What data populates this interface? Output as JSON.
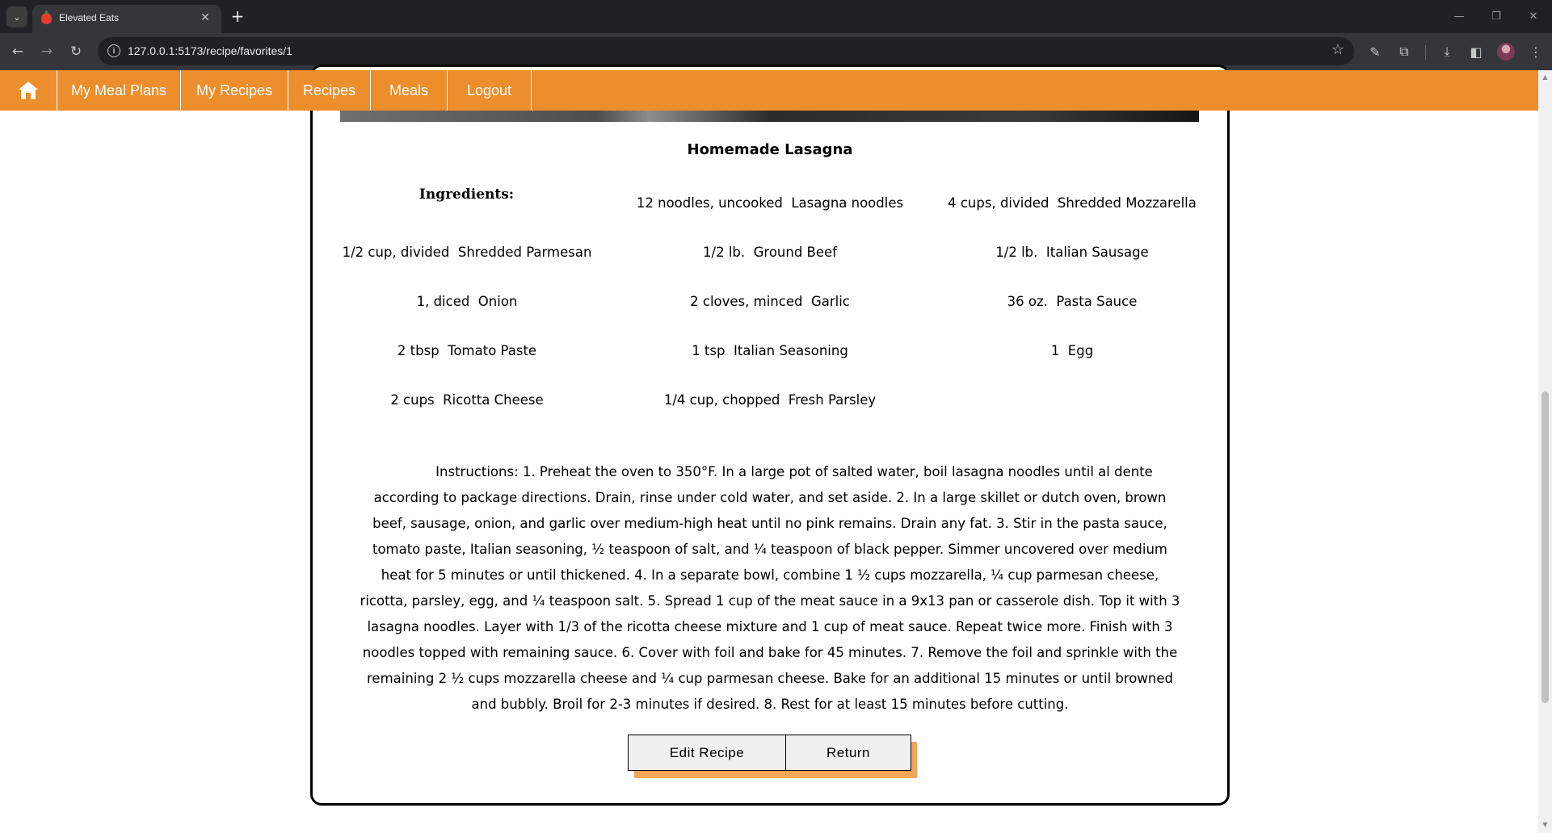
{
  "browser": {
    "tab_title": "Elevated Eats",
    "tab_close": "✕",
    "new_tab": "+",
    "url": "127.0.0.1:5173/recipe/favorites/1",
    "window_controls": {
      "minimize": "—",
      "restore": "❐",
      "close": "✕"
    },
    "icons": [
      "tab-list-icon",
      "favicon",
      "back-icon",
      "forward-icon",
      "reload-icon",
      "site-info-icon",
      "star-icon",
      "eyedropper-icon",
      "extensions-icon",
      "download-icon",
      "sidebar-icon",
      "avatar",
      "menu-icon"
    ]
  },
  "navbar": {
    "items": [
      {
        "label": "My Meal Plans"
      },
      {
        "label": "My Recipes"
      },
      {
        "label": "Recipes"
      },
      {
        "label": "Meals"
      },
      {
        "label": "Logout"
      }
    ],
    "accent_color": "#ec8e2c"
  },
  "recipe": {
    "title": "Homemade Lasagna",
    "ingredients_label": "Ingredients:",
    "ingredients": [
      "12 noodles, uncooked  Lasagna noodles",
      "4 cups, divided  Shredded Mozzarella",
      "1/2 cup, divided  Shredded Parmesan",
      "1/2 lb.  Ground Beef",
      "1/2 lb.  Italian Sausage",
      "1, diced  Onion",
      "2 cloves, minced  Garlic",
      "36 oz.  Pasta Sauce",
      "2 tbsp  Tomato Paste",
      "1 tsp  Italian Seasoning",
      "1  Egg",
      "2 cups  Ricotta Cheese",
      "1/4 cup, chopped  Fresh Parsley"
    ],
    "instructions": "Instructions: 1. Preheat the oven to 350°F. In a large pot of salted water, boil lasagna noodles until al dente according to package directions. Drain, rinse under cold water, and set aside. 2. In a large skillet or dutch oven, brown beef, sausage, onion, and garlic over medium-high heat until no pink remains. Drain any fat. 3. Stir in the pasta sauce, tomato paste, Italian seasoning, ½ teaspoon of salt, and ¼ teaspoon of black pepper. Simmer uncovered over medium heat for 5 minutes or until thickened. 4. In a separate bowl, combine 1 ½ cups mozzarella, ¼ cup parmesan cheese, ricotta, parsley, egg, and ¼ teaspoon salt. 5. Spread 1 cup of the meat sauce in a 9x13 pan or casserole dish. Top it with 3 lasagna noodles. Layer with 1/3 of the ricotta cheese mixture and 1 cup of meat sauce. Repeat twice more. Finish with 3 noodles topped with remaining sauce. 6. Cover with foil and bake for 45 minutes. 7. Remove the foil and sprinkle with the remaining 2 ½ cups mozzarella cheese and ¼ cup parmesan cheese. Bake for an additional 15 minutes or until browned and bubbly. Broil for 2-3 minutes if desired. 8. Rest for at least 15 minutes before cutting."
  },
  "actions": {
    "edit_label": "Edit Recipe",
    "return_label": "Return",
    "shadow_color": "#f3a559"
  }
}
